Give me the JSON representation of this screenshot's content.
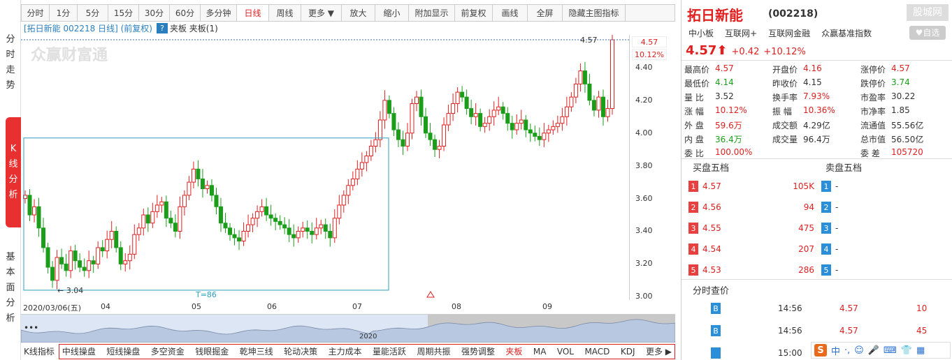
{
  "toolbar": {
    "items": [
      "分时",
      "1分",
      "5分",
      "15分",
      "30分",
      "60分",
      "多分钟",
      "日线",
      "周线",
      "更多 ▼",
      "放大",
      "缩小",
      "附加显示",
      "前复权",
      "画线",
      "全屏",
      "隐藏主图指标"
    ],
    "active": "日线"
  },
  "leftnav": {
    "groups": [
      {
        "label": "分时走势",
        "chars": [
          "分",
          "时",
          "走",
          "势"
        ]
      },
      {
        "label": "K线分析",
        "chars": [
          "K",
          "线",
          "分",
          "析"
        ]
      },
      {
        "label": "基本面分析",
        "chars": [
          "基",
          "本",
          "面",
          "分",
          "析"
        ]
      }
    ]
  },
  "chart": {
    "header": "[拓日新能 002218 日线] (前复权)",
    "qmark": "?",
    "header_tail": "夹板 夹板(1)",
    "watermark": "众赢财富通",
    "box_low_label": "3.04",
    "box_span_label": "T=86",
    "high_label": "4.57",
    "price_tag": "4.57",
    "pct_tag": "10.12%"
  },
  "chart_data": {
    "type": "candlestick",
    "yticks": [
      "4.40",
      "4.20",
      "4.00",
      "3.80",
      "3.60",
      "3.40",
      "3.20",
      "3.00"
    ],
    "ylim": [
      2.98,
      4.6
    ],
    "xlabels": [
      "2020/03/06(五)",
      "04",
      "05",
      "06",
      "07",
      "08",
      "09"
    ],
    "last_close": 4.57,
    "change": "+0.42",
    "change_pct": "+10.12%"
  },
  "overview": {
    "year_label": "2020",
    "dots": "•••"
  },
  "bottombar": {
    "first": "K线指标",
    "items": [
      "中线操盘",
      "短线操盘",
      "多空资金",
      "钱眼掘金",
      "乾坤三线",
      "轮动决策",
      "主力成本",
      "量能活跃",
      "周期共振",
      "强势调整",
      "夹板",
      "MA",
      "VOL",
      "MACD",
      "KDJ",
      "更多 ▶"
    ],
    "active": "夹板"
  },
  "panel": {
    "name": "拓日新能",
    "code": "(002218)",
    "watermark": "股城网",
    "tags": [
      "中小板",
      "互联网+",
      "互联网金融",
      "众赢基准指数"
    ],
    "fav": "♥自选",
    "price": "4.57⬆",
    "change": "+0.42",
    "change_pct": "+10.12%",
    "stats": [
      [
        {
          "k": "最高价",
          "v": "4.57",
          "c": "red"
        },
        {
          "k": "开盘价",
          "v": "4.16",
          "c": "red"
        },
        {
          "k": "涨停价",
          "v": "4.57",
          "c": "red"
        }
      ],
      [
        {
          "k": "最低价",
          "v": "4.14",
          "c": "green"
        },
        {
          "k": "昨收价",
          "v": "4.15",
          "c": "dark"
        },
        {
          "k": "跌停价",
          "v": "3.74",
          "c": "green"
        }
      ],
      [
        {
          "k": "量 比",
          "v": "3.52",
          "c": "dark"
        },
        {
          "k": "换手率",
          "v": "7.93%",
          "c": "red"
        },
        {
          "k": "市盈率",
          "v": "30.22",
          "c": "dark"
        }
      ],
      [
        {
          "k": "涨 幅",
          "v": "10.12%",
          "c": "red"
        },
        {
          "k": "振 幅",
          "v": "10.36%",
          "c": "red"
        },
        {
          "k": "市净率",
          "v": "1.85",
          "c": "dark"
        }
      ],
      [
        {
          "k": "外 盘",
          "v": "59.6万",
          "c": "red"
        },
        {
          "k": "成交额",
          "v": "4.29亿",
          "c": "dark"
        },
        {
          "k": "流通值",
          "v": "55.56亿",
          "c": "dark"
        }
      ],
      [
        {
          "k": "内 盘",
          "v": "36.4万",
          "c": "green"
        },
        {
          "k": "成交量",
          "v": "96.4万",
          "c": "dark"
        },
        {
          "k": "总市值",
          "v": "56.50亿",
          "c": "dark"
        }
      ],
      [
        {
          "k": "委 比",
          "v": "100.00%",
          "c": "red"
        },
        {
          "k": "",
          "v": "",
          "c": "dark"
        },
        {
          "k": "委 差",
          "v": "105720",
          "c": "red"
        }
      ]
    ],
    "buy_head": "买盘五档",
    "sell_head": "卖盘五档",
    "buy": [
      {
        "n": "1",
        "p": "4.57",
        "v": "105K"
      },
      {
        "n": "2",
        "p": "4.56",
        "v": "94"
      },
      {
        "n": "3",
        "p": "4.55",
        "v": "475"
      },
      {
        "n": "4",
        "p": "4.54",
        "v": "207"
      },
      {
        "n": "5",
        "p": "4.53",
        "v": "286"
      }
    ],
    "sell": [
      {
        "n": "1",
        "p": "-"
      },
      {
        "n": "2",
        "p": "-"
      },
      {
        "n": "3",
        "p": "-"
      },
      {
        "n": "4",
        "p": "-"
      },
      {
        "n": "5",
        "p": "-"
      }
    ],
    "ticks_head": "分时查价",
    "ticks": [
      {
        "b": "B",
        "t": "14:56",
        "p": "4.57",
        "v": "10"
      },
      {
        "b": "B",
        "t": "14:56",
        "p": "4.57",
        "v": "45"
      },
      {
        "b": "",
        "t": "15:00",
        "p": "",
        "v": ""
      }
    ]
  },
  "ime": {
    "logo": "S",
    "items": [
      "中",
      "·,",
      "☺",
      "🎤",
      "⌨",
      "👕",
      "▦"
    ]
  }
}
